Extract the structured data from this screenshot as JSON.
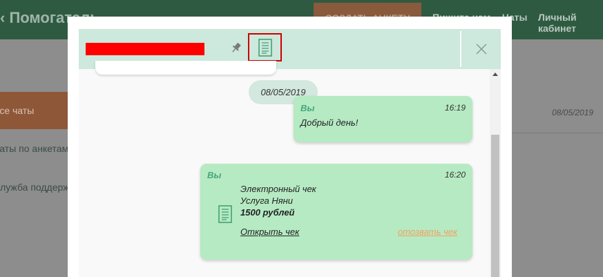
{
  "background": {
    "logo_text": "‹ Помогатель",
    "create_button": "СОЗДАТЬ АНКЕТУ",
    "nav": [
      "Пишите нам",
      "Чаты",
      "Личный кабинет"
    ],
    "sidebar": [
      "Все чаты",
      "Чаты по анкетам",
      "Служба поддержки"
    ],
    "chat_date": "08/05/2019"
  },
  "modal": {
    "header": {
      "pin_icon": "pin-icon",
      "receipt_icon": "receipt-icon",
      "close_icon": "close-icon"
    },
    "date_separator": "08/05/2019",
    "messages": [
      {
        "sender": "Вы",
        "time": "16:19",
        "text": "Добрый день!"
      },
      {
        "sender": "Вы",
        "time": "16:20",
        "receipt": {
          "title": "Электронный чек",
          "service": "Услуга Няни",
          "amount": "1500 рублей",
          "open_link": "Открыть чек",
          "revoke_link": "отозвать чек"
        }
      }
    ]
  },
  "colors": {
    "header_bg": "#cde8dc",
    "bubble_bg": "#b6eac3",
    "sender_color": "#46a77c",
    "revoke_color": "#f0a062",
    "highlight_border": "#cc0000"
  }
}
